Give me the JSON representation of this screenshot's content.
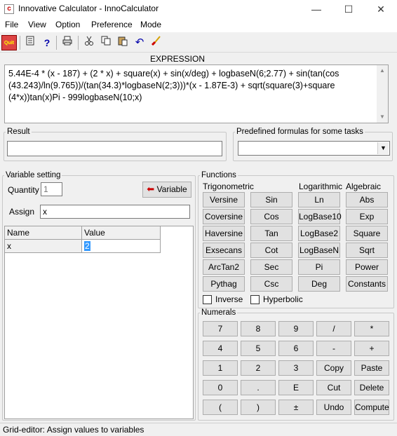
{
  "window": {
    "title": "Innovative Calculator - InnoCalculator",
    "minimize": "—",
    "maximize": "☐",
    "close": "✕"
  },
  "menu": [
    "File",
    "View",
    "Option",
    "Preference",
    "Mode"
  ],
  "toolbar": {
    "quit_label": "Quit"
  },
  "expression": {
    "label": "EXPRESSION",
    "text": "5.44E-4 * (x - 187) + (2 * x) + square(x) + sin(x/deg) + logbaseN(6;2.77) + sin(tan(cos (43.243)/ln(9.765))/(tan(34.3)*logbaseN(2;3)))*(x - 1.87E-3) + sqrt(square(3)+square (4*x))tan(x)Pi - 999logbaseN(10;x)"
  },
  "result": {
    "label": "Result",
    "value": ""
  },
  "predefined": {
    "label": "Predefined formulas for some tasks",
    "value": ""
  },
  "variable": {
    "label": "Variable setting",
    "quantity_label": "Quantity",
    "quantity_value": "1",
    "variable_button": "Variable",
    "assign_label": "Assign",
    "assign_value": "x",
    "grid_headers": [
      "Name",
      "Value"
    ],
    "grid_rows": [
      {
        "name": "x",
        "value": "2"
      }
    ]
  },
  "functions": {
    "label": "Functions",
    "trig_label": "Trigonometric",
    "log_label": "Logarithmic",
    "alg_label": "Algebraic",
    "trig_col1": [
      "Versine",
      "Coversine",
      "Haversine",
      "Exsecans",
      "ArcTan2",
      "Pythag"
    ],
    "trig_col2": [
      "Sin",
      "Cos",
      "Tan",
      "Cot",
      "Sec",
      "Csc"
    ],
    "log_col": [
      "Ln",
      "LogBase10",
      "LogBase2",
      "LogBaseN",
      "Pi",
      "Deg"
    ],
    "alg_col": [
      "Abs",
      "Exp",
      "Square",
      "Sqrt",
      "Power",
      "Constants"
    ],
    "inverse_label": "Inverse",
    "hyperbolic_label": "Hyperbolic"
  },
  "numerals": {
    "label": "Numerals",
    "rows": [
      [
        "7",
        "8",
        "9",
        "/",
        "*"
      ],
      [
        "4",
        "5",
        "6",
        "-",
        "+"
      ],
      [
        "1",
        "2",
        "3",
        "Copy",
        "Paste"
      ],
      [
        "0",
        ".",
        "E",
        "Cut",
        "Delete"
      ],
      [
        "(",
        ")",
        "±",
        "Undo",
        "Compute"
      ]
    ]
  },
  "status": {
    "text": "Grid-editor: Assign values to variables"
  }
}
